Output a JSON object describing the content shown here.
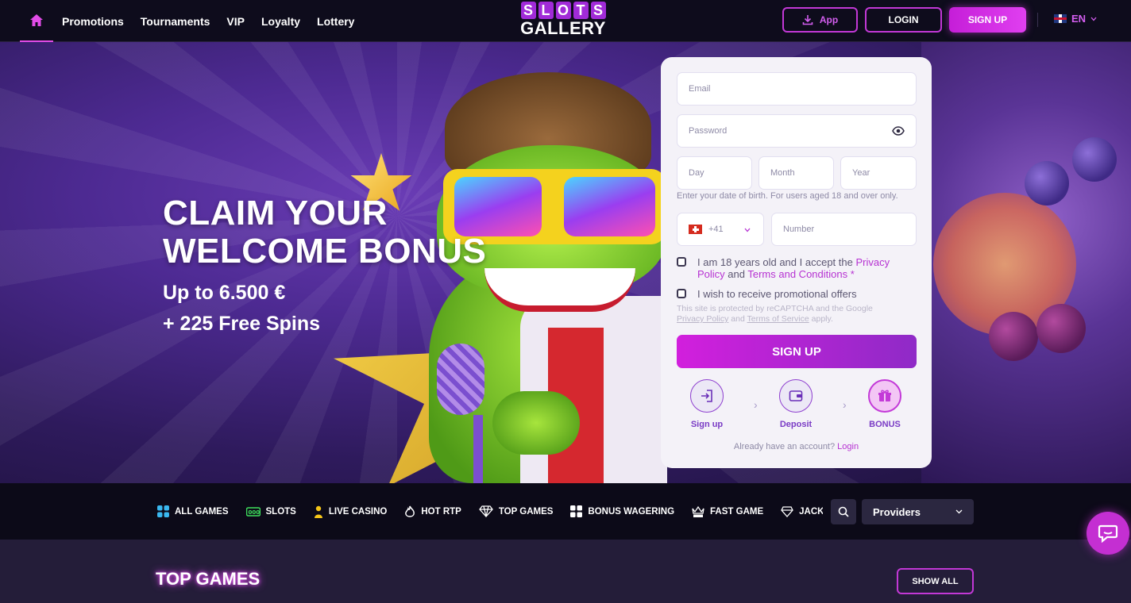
{
  "header": {
    "nav": [
      "Promotions",
      "Tournaments",
      "VIP",
      "Loyalty",
      "Lottery"
    ],
    "logo_top": [
      "S",
      "L",
      "O",
      "T",
      "S"
    ],
    "logo_bottom": "GALLERY",
    "app_label": "App",
    "login_label": "LOGIN",
    "signup_label": "SIGN UP",
    "language": "EN"
  },
  "hero": {
    "line1": "CLAIM YOUR",
    "line2": "WELCOME BONUS",
    "line3": "Up to 6.500 €",
    "line4": "+ 225 Free Spins"
  },
  "form": {
    "email_placeholder": "Email",
    "password_placeholder": "Password",
    "day_placeholder": "Day",
    "month_placeholder": "Month",
    "year_placeholder": "Year",
    "dob_hint": "Enter your date of birth. For users aged 18 and over only.",
    "phone_code": "+41",
    "number_placeholder": "Number",
    "terms_part1": "I am 18 years old and I accept the ",
    "terms_privacy": "Privacy Policy",
    "terms_and": " and ",
    "terms_tc": "Terms and Conditions",
    "terms_star": " *",
    "promo_text": "I wish to receive promotional offers",
    "recaptcha_1": "This site is protected by reCAPTCHA and the Google",
    "recaptcha_privacy": "Privacy Policy",
    "recaptcha_and": " and ",
    "recaptcha_terms": "Terms of Service",
    "recaptcha_apply": " apply.",
    "signup_button": "SIGN UP",
    "steps": [
      "Sign up",
      "Deposit",
      "BONUS"
    ],
    "already_text": "Already have an account? ",
    "already_link": "Login"
  },
  "categories": [
    "ALL GAMES",
    "SLOTS",
    "LIVE CASINO",
    "HOT RTP",
    "TOP GAMES",
    "BONUS WAGERING",
    "FAST GAME",
    "JACKPOTS"
  ],
  "providers_label": "Providers",
  "section": {
    "title": "TOP GAMES",
    "show_all": "SHOW ALL"
  },
  "colors": {
    "accent": "#c238d6",
    "accent_bright": "#e03ff0",
    "header_bg": "#0e0c1c",
    "card_bg": "#f4f2f8"
  }
}
